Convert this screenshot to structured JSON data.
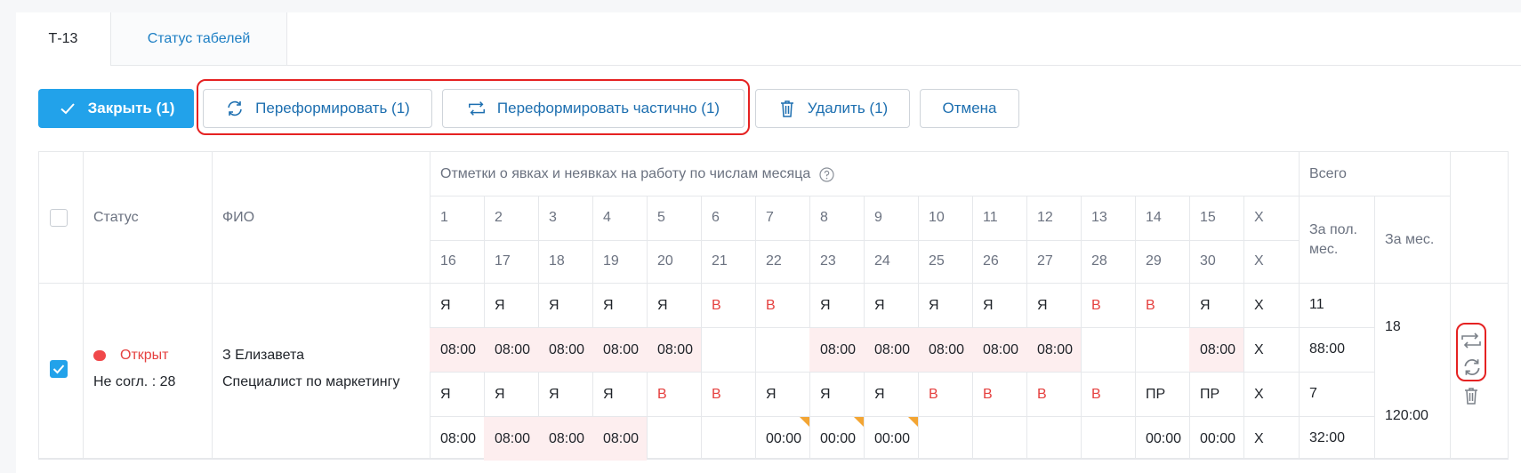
{
  "tabs": [
    {
      "label": "Т-13",
      "active": true
    },
    {
      "label": "Статус табелей",
      "active": false
    }
  ],
  "toolbar": {
    "close_label": "Закрыть (1)",
    "reform_label": "Переформировать (1)",
    "reform_partial_label": "Переформировать частично (1)",
    "delete_label": "Удалить (1)",
    "cancel_label": "Отмена"
  },
  "table": {
    "headers": {
      "status": "Статус",
      "fio": "ФИО",
      "marks": "Отметки о явках и неявках на работу по числам месяца",
      "total": "Всего",
      "half_month": "За пол. мес.",
      "month": "За мес."
    },
    "days_row1": [
      "1",
      "2",
      "3",
      "4",
      "5",
      "6",
      "7",
      "8",
      "9",
      "10",
      "11",
      "12",
      "13",
      "14",
      "15",
      "Х"
    ],
    "days_row2": [
      "16",
      "17",
      "18",
      "19",
      "20",
      "21",
      "22",
      "23",
      "24",
      "25",
      "26",
      "27",
      "28",
      "29",
      "30",
      "Х"
    ],
    "row": {
      "checked": true,
      "status": "Открыт",
      "status_color": "#f0484a",
      "approval": "Не согл. : 28",
      "name": "З Елизавета",
      "position": "Специалист по маркетингу",
      "codes1": [
        "Я",
        "Я",
        "Я",
        "Я",
        "Я",
        "В",
        "В",
        "Я",
        "Я",
        "Я",
        "Я",
        "Я",
        "В",
        "В",
        "Я",
        "Х"
      ],
      "hours1": [
        "08:00",
        "08:00",
        "08:00",
        "08:00",
        "08:00",
        "",
        "",
        "08:00",
        "08:00",
        "08:00",
        "08:00",
        "08:00",
        "",
        "",
        "08:00",
        "Х"
      ],
      "codes2": [
        "Я",
        "Я",
        "Я",
        "Я",
        "В",
        "В",
        "Я",
        "Я",
        "Я",
        "В",
        "В",
        "В",
        "В",
        "ПР",
        "ПР",
        "Х"
      ],
      "hours2": [
        "08:00",
        "08:00",
        "08:00",
        "08:00",
        "",
        "",
        "00:00",
        "00:00",
        "00:00",
        "",
        "",
        "",
        "",
        "00:00",
        "00:00",
        "Х"
      ],
      "half1_days": "11",
      "half1_hours": "88:00",
      "half2_days": "7",
      "half2_hours": "32:00",
      "month_days": "18",
      "month_hours": "120:00"
    }
  },
  "colors": {
    "accent": "#22a2ea",
    "link": "#1d6fb0",
    "weekend": "#e5403f",
    "highlight": "#fdeeef",
    "flag": "#f3a533",
    "outline_red": "#e52222"
  }
}
